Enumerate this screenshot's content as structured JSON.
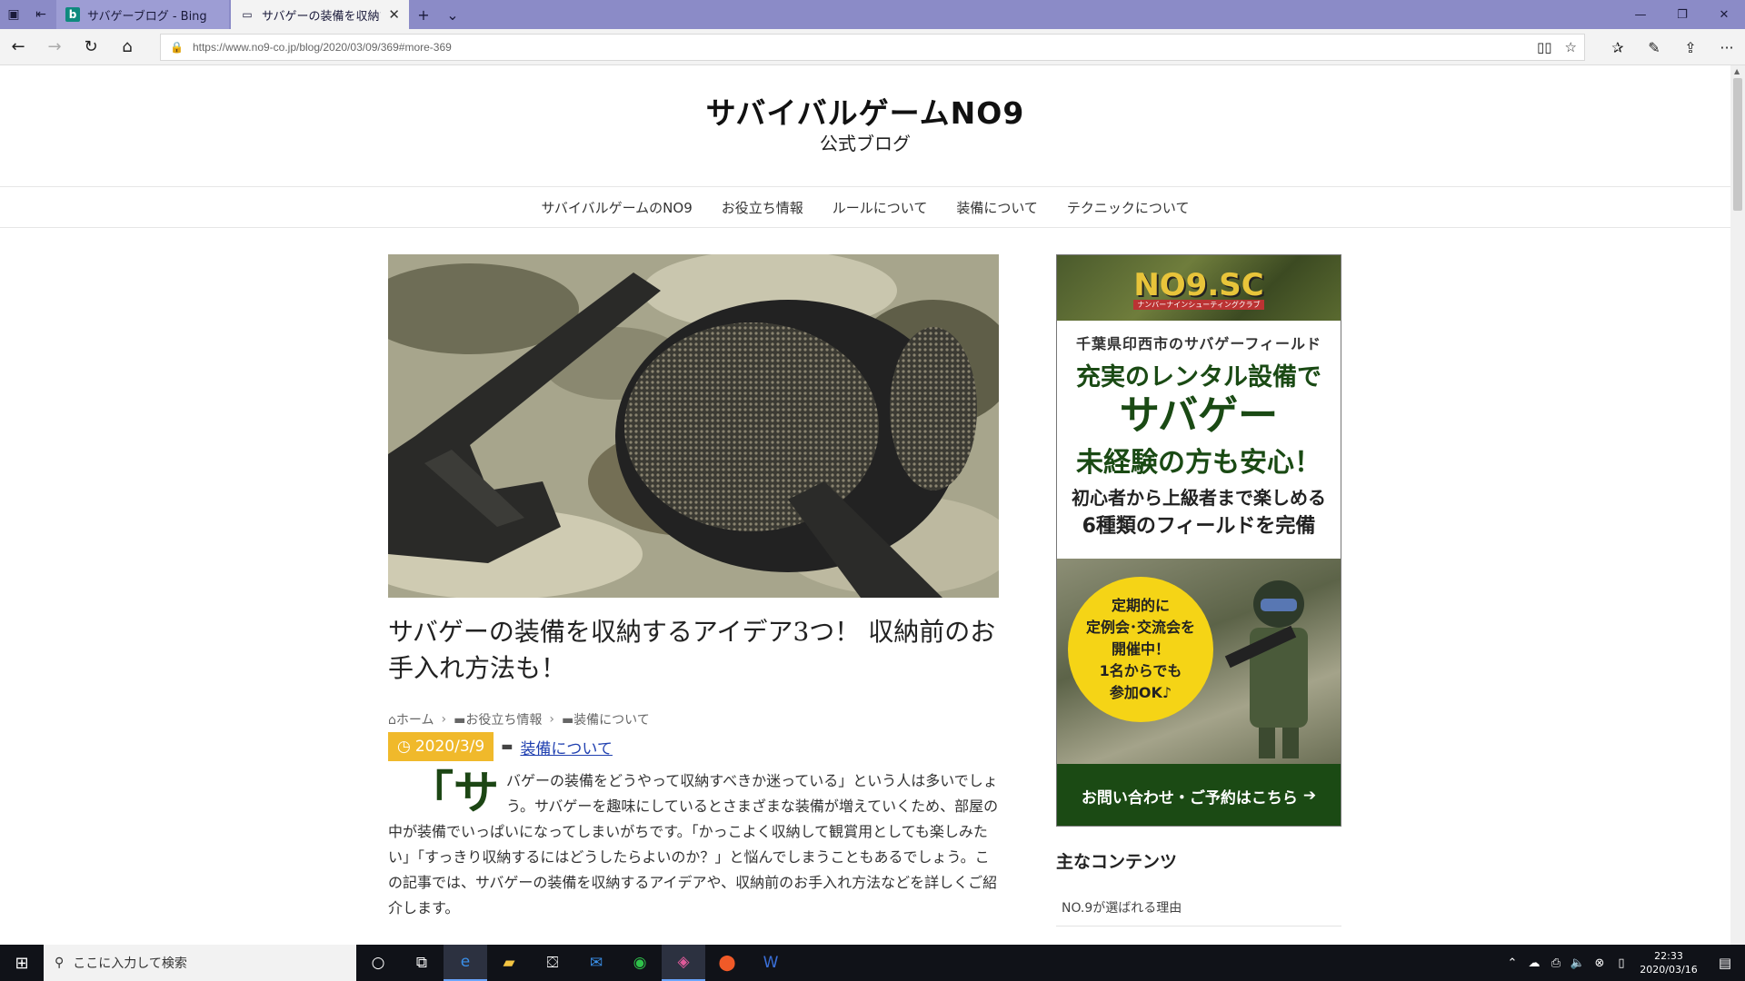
{
  "browser": {
    "tabs": [
      {
        "title": "サバゲーブログ - Bing",
        "icon": "bing-icon"
      },
      {
        "title": "サバゲーの装備を収納する",
        "icon": "page-icon",
        "active": true
      }
    ],
    "url": "https://www.no9-co.jp/blog/2020/03/09/369#more-369"
  },
  "site": {
    "title": "サバイバルゲームNO9",
    "subtitle": "公式ブログ",
    "nav": [
      "サバイバルゲームのNO9",
      "お役立ち情報",
      "ルールについて",
      "装備について",
      "テクニックについて"
    ]
  },
  "article": {
    "title": "サバゲーの装備を収納するアイデア3つ！ 収納前のお手入れ方法も！",
    "breadcrumb": [
      "ホーム",
      "お役立ち情報",
      "装備について"
    ],
    "date": "2020/3/9",
    "category": "装備について",
    "dropcap": "「サ",
    "body": "バゲーの装備をどうやって収納すべきか迷っている」という人は多いでしょう。サバゲーを趣味にしているとさまざまな装備が増えていくため、部屋の中が装備でいっぱいになってしまいがちです。「かっこよく収納して観賞用としても楽しみたい」「すっきり収納するにはどうしたらよいのか？」と悩んでしまうこともあるでしょう。この記事では、サバゲーの装備を収納するアイデアや、収納前のお手入れ方法などを詳しくご紹介します。"
  },
  "sidebar": {
    "ad": {
      "logo": "NO9.SC",
      "logo_sub": "ナンバーナインシューティングクラブ",
      "line1": "千葉県印西市のサバゲーフィールド",
      "line2": "充実のレンタル設備で",
      "line3": "サバゲー",
      "line4": "未経験の方も安心！",
      "line5": "初心者から上級者まで楽しめる",
      "line6": "6種類のフィールドを完備",
      "bubble": [
        "定期的に",
        "定例会･交流会を",
        "開催中！",
        "1名からでも",
        "参加OK♪"
      ],
      "footer": "お問い合わせ・ご予約はこちら"
    },
    "heading": "主なコンテンツ",
    "items": [
      "NO.9が選ばれる理由"
    ]
  },
  "taskbar": {
    "search_placeholder": "ここに入力して検索",
    "time": "22:33",
    "date": "2020/03/16"
  },
  "colors": {
    "accent_yellow": "#f0b92b",
    "ad_green": "#1b4a14",
    "tab_bar": "#8b8bc7"
  }
}
